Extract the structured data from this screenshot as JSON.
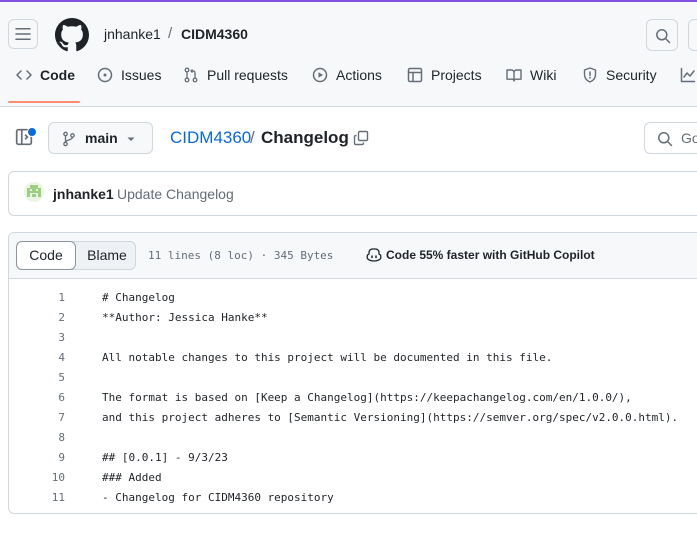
{
  "header": {
    "owner": "jnhanke1",
    "separator": "/",
    "repo": "CIDM4360"
  },
  "tabs": [
    {
      "label": "Code",
      "icon": "code-icon",
      "active": true
    },
    {
      "label": "Issues",
      "icon": "issue-opened-icon"
    },
    {
      "label": "Pull requests",
      "icon": "git-pull-request-icon"
    },
    {
      "label": "Actions",
      "icon": "play-icon"
    },
    {
      "label": "Projects",
      "icon": "table-icon"
    },
    {
      "label": "Wiki",
      "icon": "book-icon"
    },
    {
      "label": "Security",
      "icon": "shield-icon"
    }
  ],
  "file_nav": {
    "branch": "main",
    "repo_link": "CIDM4360",
    "separator": "/",
    "file_name": "Changelog",
    "goto_placeholder": "Go"
  },
  "commit": {
    "author": "jnhanke1",
    "message": "Update Changelog"
  },
  "file_header": {
    "code_label": "Code",
    "blame_label": "Blame",
    "info": "11 lines (8 loc) · 345 Bytes",
    "copilot": "Code 55% faster with GitHub Copilot"
  },
  "code_lines": [
    {
      "num": "1",
      "text": "# Changelog"
    },
    {
      "num": "2",
      "text": "**Author: Jessica Hanke**"
    },
    {
      "num": "3",
      "text": ""
    },
    {
      "num": "4",
      "text": "All notable changes to this project will be documented in this file."
    },
    {
      "num": "5",
      "text": ""
    },
    {
      "num": "6",
      "text": "The format is based on [Keep a Changelog](https://keepachangelog.com/en/1.0.0/),"
    },
    {
      "num": "7",
      "text": "and this project adheres to [Semantic Versioning](https://semver.org/spec/v2.0.0.html)."
    },
    {
      "num": "8",
      "text": ""
    },
    {
      "num": "9",
      "text": "## [0.0.1] - 9/3/23"
    },
    {
      "num": "10",
      "text": "### Added"
    },
    {
      "num": "11",
      "text": "- Changelog for CIDM4360 repository"
    }
  ],
  "colors": {
    "accent_purple": "#8250df",
    "link_blue": "#0969da",
    "tab_underline": "#fd8c73"
  }
}
